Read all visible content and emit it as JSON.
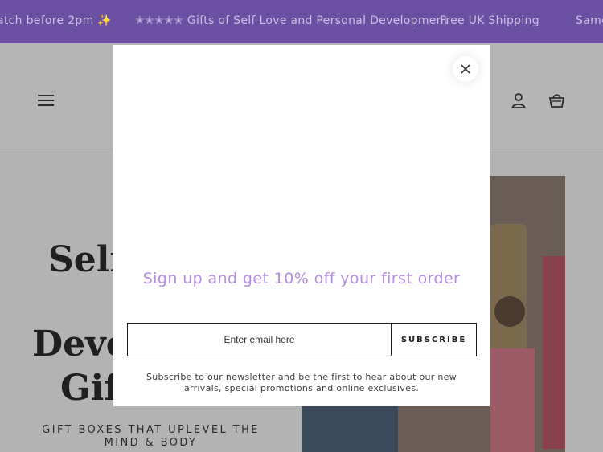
{
  "announcement": {
    "items": [
      "atch before 2pm ✨",
      "✭✭✭✭✭ Gifts of Self Love and Personal Development",
      "Free UK Shipping",
      "Same"
    ]
  },
  "header": {
    "menu_icon": "hamburger-icon",
    "account_icon": "account-icon",
    "cart_icon": "bag-icon"
  },
  "hero": {
    "title_line1": "Self",
    "title_line2": "Deve",
    "title_line3": "Gif",
    "subtitle": "GIFT BOXES THAT UPLEVEL THE MIND & BODY"
  },
  "modal": {
    "heading": "Sign up and get 10% off your first order",
    "email_placeholder": "Enter email here",
    "subscribe_label": "SUBSCRIBE",
    "note": "Subscribe to our newsletter and be the first to hear about our new arrivals, special promotions and online exclusives.",
    "close_icon": "close-icon"
  },
  "colors": {
    "announcement_bg": "#6c50a4",
    "heading_accent": "#b58de0",
    "overlay": "#b3b3b3"
  }
}
